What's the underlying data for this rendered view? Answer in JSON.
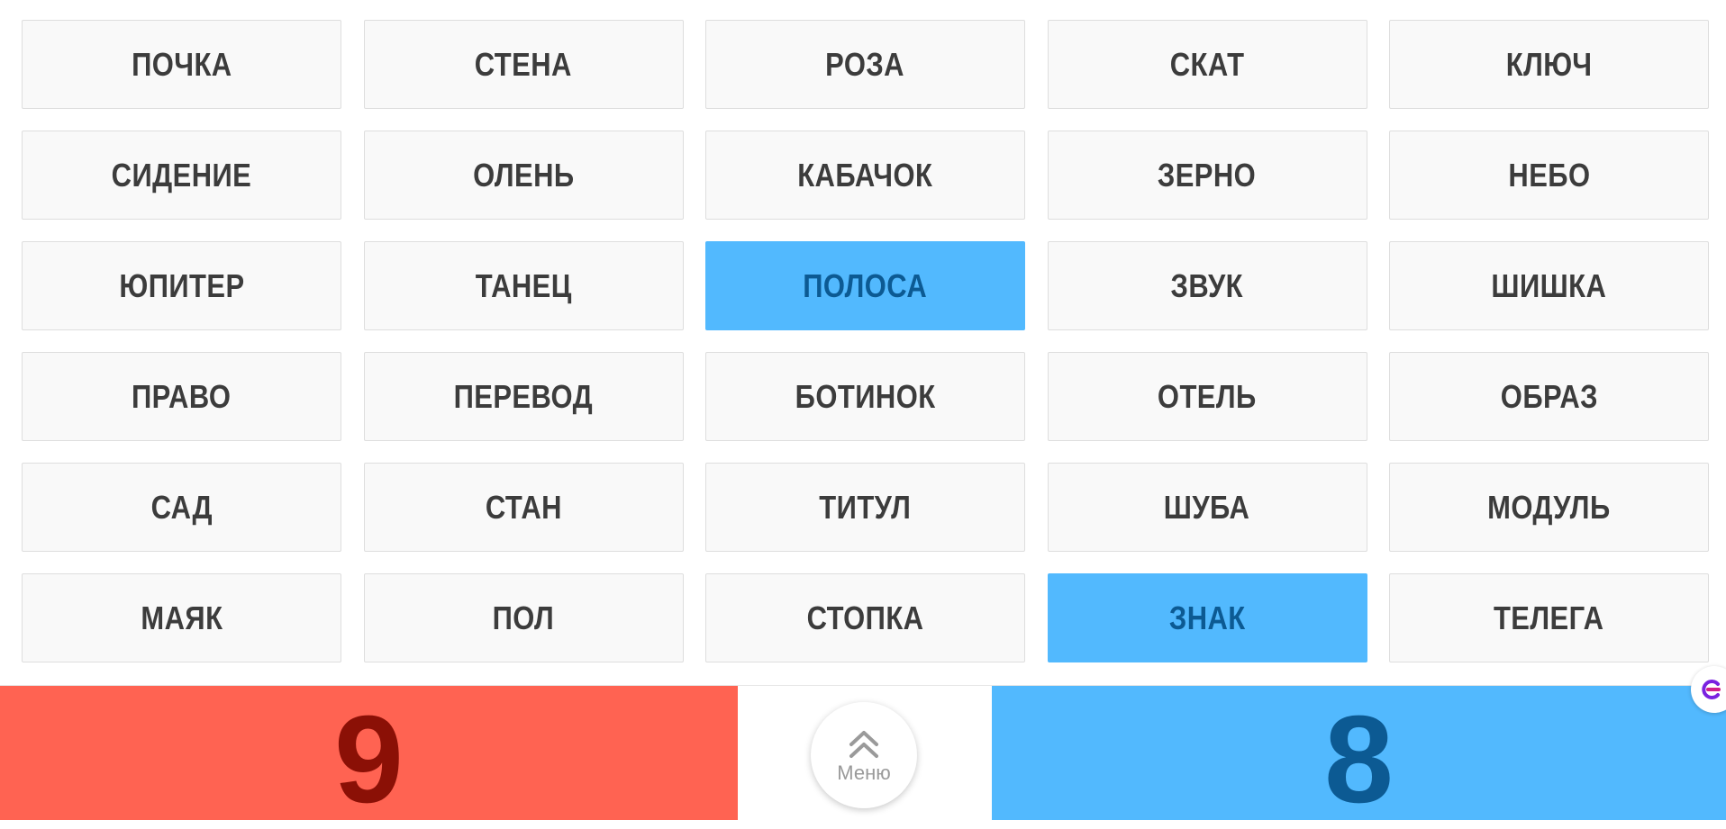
{
  "board": {
    "cards": [
      {
        "word": "ПОЧКА",
        "state": "neutral"
      },
      {
        "word": "СТЕНА",
        "state": "neutral"
      },
      {
        "word": "РОЗА",
        "state": "neutral"
      },
      {
        "word": "СКАТ",
        "state": "neutral"
      },
      {
        "word": "КЛЮЧ",
        "state": "neutral"
      },
      {
        "word": "СИДЕНИЕ",
        "state": "neutral"
      },
      {
        "word": "ОЛЕНЬ",
        "state": "neutral"
      },
      {
        "word": "КАБАЧОК",
        "state": "neutral"
      },
      {
        "word": "ЗЕРНО",
        "state": "neutral"
      },
      {
        "word": "НЕБО",
        "state": "neutral"
      },
      {
        "word": "ЮПИТЕР",
        "state": "neutral"
      },
      {
        "word": "ТАНЕЦ",
        "state": "neutral"
      },
      {
        "word": "ПОЛОСА",
        "state": "blue"
      },
      {
        "word": "ЗВУК",
        "state": "neutral"
      },
      {
        "word": "ШИШКА",
        "state": "neutral"
      },
      {
        "word": "ПРАВО",
        "state": "neutral"
      },
      {
        "word": "ПЕРЕВОД",
        "state": "neutral"
      },
      {
        "word": "БОТИНОК",
        "state": "neutral"
      },
      {
        "word": "ОТЕЛЬ",
        "state": "neutral"
      },
      {
        "word": "ОБРАЗ",
        "state": "neutral"
      },
      {
        "word": "САД",
        "state": "neutral"
      },
      {
        "word": "СТАН",
        "state": "neutral"
      },
      {
        "word": "ТИТУЛ",
        "state": "neutral"
      },
      {
        "word": "ШУБА",
        "state": "neutral"
      },
      {
        "word": "МОДУЛЬ",
        "state": "neutral"
      },
      {
        "word": "МАЯК",
        "state": "neutral"
      },
      {
        "word": "ПОЛ",
        "state": "neutral"
      },
      {
        "word": "СТОПКА",
        "state": "neutral"
      },
      {
        "word": "ЗНАК",
        "state": "blue"
      },
      {
        "word": "ТЕЛЕГА",
        "state": "neutral"
      }
    ]
  },
  "scores": {
    "red": "9",
    "blue": "8"
  },
  "menu": {
    "label": "Меню",
    "icon": "chevron-double-up-icon"
  },
  "colors": {
    "red_team": "#ff6352",
    "red_text": "#8b1006",
    "blue_team": "#52b9fe",
    "blue_text": "#0c5a93",
    "card_bg": "#f9f9f9",
    "card_text": "#3c3c3c"
  }
}
